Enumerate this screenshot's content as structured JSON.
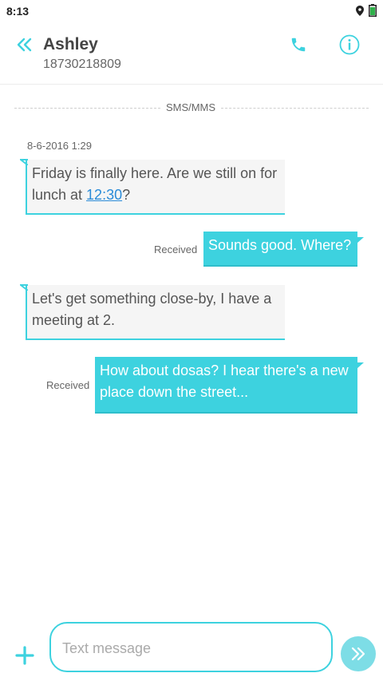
{
  "status_bar": {
    "time": "8:13",
    "icons": [
      "location-icon",
      "battery-icon"
    ]
  },
  "header": {
    "contact_name": "Ashley",
    "contact_number": "18730218809",
    "icons": [
      "back-icon",
      "phone-icon",
      "info-icon"
    ]
  },
  "conversation": {
    "divider_label": "SMS/MMS",
    "timestamp": "8-6-2016 1:29",
    "messages": [
      {
        "direction": "incoming",
        "text_before_link": "Friday is finally here. Are we still on for lunch at ",
        "link_text": "12:30",
        "text_after_link": "?"
      },
      {
        "direction": "outgoing",
        "status": "Received",
        "text": "Sounds good. Where?"
      },
      {
        "direction": "incoming",
        "text": "Let's get something close-by, I have a meeting at 2."
      },
      {
        "direction": "outgoing",
        "status": "Received",
        "text": "How about dosas? I hear there's a new place down the street..."
      }
    ]
  },
  "composer": {
    "placeholder": "Text message",
    "value": "",
    "icons": [
      "add-icon",
      "send-icon"
    ]
  },
  "colors": {
    "accent": "#3dd2df",
    "send_button": "#7ddde6",
    "incoming_bubble": "#f5f5f5",
    "link": "#2a8bd8"
  }
}
